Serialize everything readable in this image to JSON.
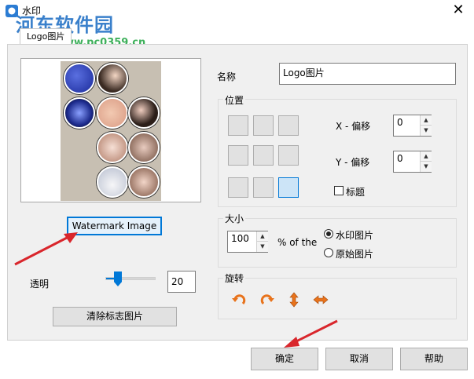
{
  "window": {
    "title": "水印",
    "close_glyph": "✕"
  },
  "overlay_watermark": {
    "logo_text": "河东软件园",
    "url_text": "www.pc0359.cn"
  },
  "tab": {
    "label": "Logo图片"
  },
  "left": {
    "watermark_image_button": "Watermark Image",
    "transparency_label": "透明",
    "transparency_value": "20",
    "transparency_fraction": 0.2,
    "clear_logo_button": "清除标志图片"
  },
  "name": {
    "label": "名称",
    "value": "Logo图片"
  },
  "position": {
    "title": "位置",
    "selected_cell": "bottom-right",
    "x_label": "X - 偏移",
    "x_value": "0",
    "y_label": "Y - 偏移",
    "y_value": "0",
    "title_checkbox_label": "标题",
    "title_checkbox_checked": false
  },
  "size": {
    "title": "大小",
    "value": "100",
    "of_the_label": "% of the",
    "option_watermark": "水印图片",
    "option_original": "原始图片",
    "selected": "水印图片"
  },
  "rotate": {
    "title": "旋转",
    "icons": [
      "rotate-left-icon",
      "rotate-right-icon",
      "flip-vertical-icon",
      "flip-horizontal-icon"
    ],
    "icon_color": "#e8731c"
  },
  "footer": {
    "ok_button": "确定",
    "cancel_button": "取消",
    "help_button": "帮助"
  },
  "colors": {
    "accent": "#0078d7",
    "annotation_arrow": "#d9262c"
  }
}
